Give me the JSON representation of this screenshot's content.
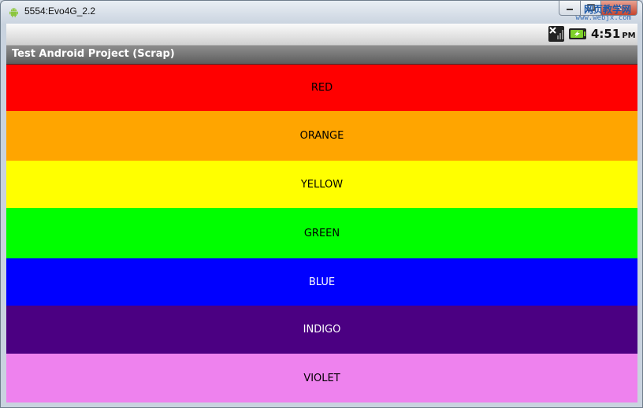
{
  "window": {
    "title": "5554:Evo4G_2.2",
    "icon": "android-icon",
    "controls": {
      "minimize_icon": "minimize-icon",
      "maximize_icon": "maximize-icon",
      "close_label": "✕"
    },
    "watermark": {
      "line1": "网页教学网",
      "line2": "www.webjx.com"
    }
  },
  "statusbar": {
    "signal_icon": "no-signal-icon",
    "battery_icon": "battery-charging-icon",
    "time": "4:51",
    "ampm": "PM"
  },
  "app": {
    "title": "Test Android Project (Scrap)"
  },
  "colors": {
    "red": "#FF0000",
    "orange": "#FFA500",
    "yellow": "#FFFF00",
    "green": "#00FF00",
    "blue": "#0000FF",
    "indigo": "#4B0082",
    "violet": "#EE82EE"
  },
  "bands": [
    {
      "label": "RED",
      "color": "#FF0000",
      "text_color": "#000000"
    },
    {
      "label": "ORANGE",
      "color": "#FFA500",
      "text_color": "#000000"
    },
    {
      "label": "YELLOW",
      "color": "#FFFF00",
      "text_color": "#000000"
    },
    {
      "label": "GREEN",
      "color": "#00FF00",
      "text_color": "#000000"
    },
    {
      "label": "BLUE",
      "color": "#0000FF",
      "text_color": "#FFFFFF"
    },
    {
      "label": "INDIGO",
      "color": "#4B0082",
      "text_color": "#FFFFFF"
    },
    {
      "label": "VIOLET",
      "color": "#EE82EE",
      "text_color": "#000000"
    }
  ]
}
